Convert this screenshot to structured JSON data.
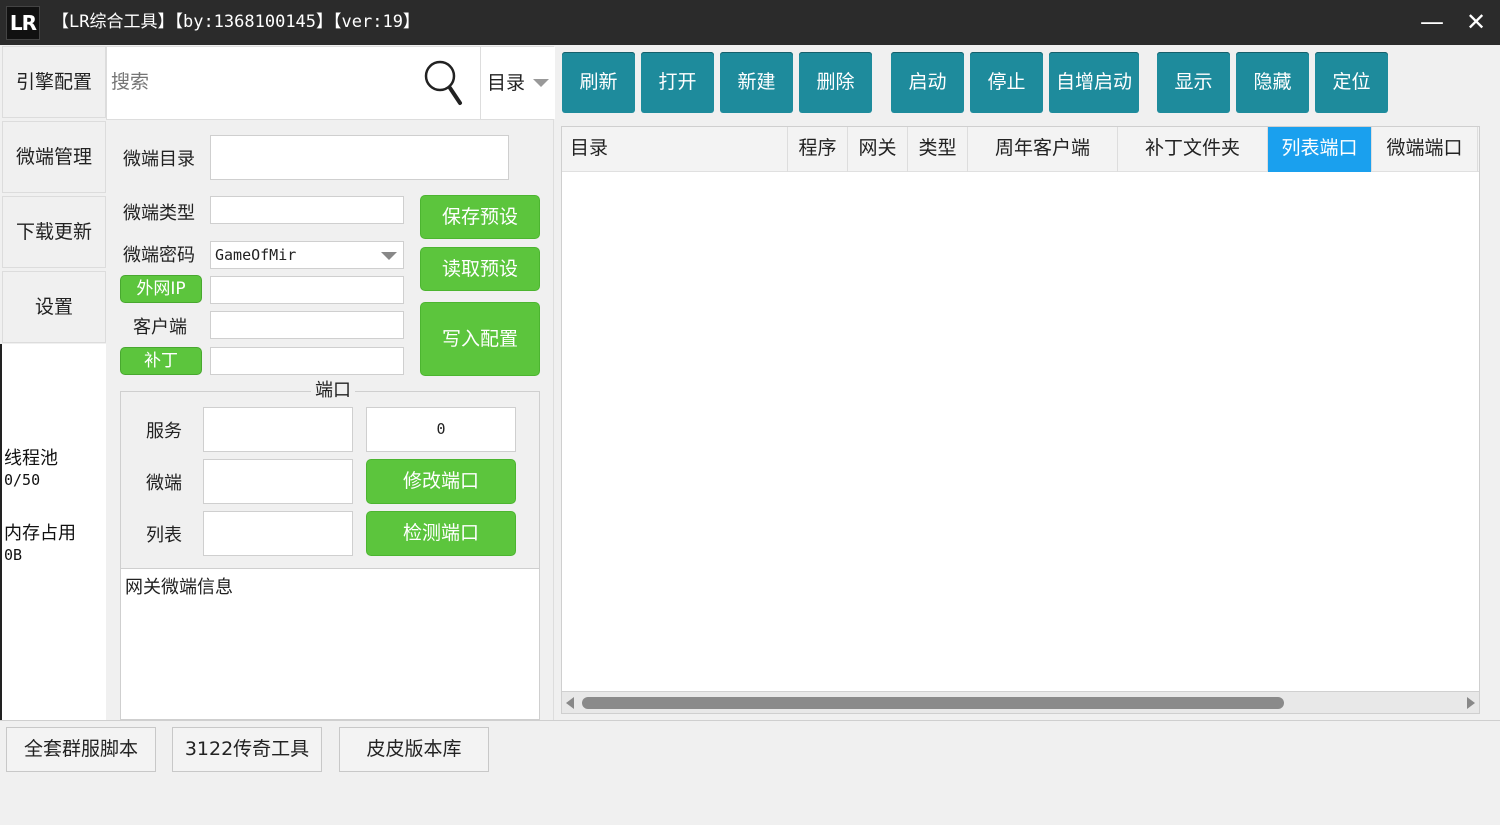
{
  "titlebar": {
    "logo": "LR",
    "title": "【LR综合工具】【by:1368100145】【ver:19】",
    "minimize": "—",
    "close": "✕"
  },
  "left_nav": {
    "items": [
      "引擎配置",
      "微端管理",
      "下载更新",
      "设置"
    ],
    "thread_pool_label": "线程池",
    "thread_pool_value": "0/50",
    "memory_label": "内存占用",
    "memory_value": "0B"
  },
  "search": {
    "placeholder": "搜索",
    "dir_select": "目录"
  },
  "toolbar": [
    "刷新",
    "打开",
    "新建",
    "删除",
    "启动",
    "停止",
    "自增启动",
    "显示",
    "隐藏",
    "定位"
  ],
  "form": {
    "dir_label": "微端目录",
    "dir_value": "",
    "type_label": "微端类型",
    "type_value": "",
    "password_label": "微端密码",
    "password_value": "GameOfMir",
    "ext_ip_label": "外网IP",
    "ext_ip_value": "",
    "client_label": "客户端",
    "client_value": "",
    "patch_label": "补丁",
    "patch_value": "",
    "save_preset": "保存预设",
    "load_preset": "读取预设",
    "write_config": "写入配置"
  },
  "ports": {
    "legend": "端口",
    "service_label": "服务",
    "service_value": "",
    "service_port": "0",
    "micro_label": "微端",
    "micro_value": "",
    "list_label": "列表",
    "list_value": "",
    "modify_button": "修改端口",
    "check_button": "检测端口"
  },
  "info": {
    "header": "网关微端信息"
  },
  "grid": {
    "columns": [
      "目录",
      "程序",
      "网关",
      "类型",
      "周年客户端",
      "补丁文件夹",
      "列表端口",
      "微端端口"
    ],
    "active_column": "列表端口",
    "scroll_fraction": 0.8
  },
  "bottom": [
    "全套群服脚本",
    "3122传奇工具",
    "皮皮版本库"
  ],
  "colors": {
    "titlebar": "#2b2b2b",
    "teal": "#1e8b9c",
    "green": "#5cc53d",
    "active_header": "#1aa0ee"
  }
}
